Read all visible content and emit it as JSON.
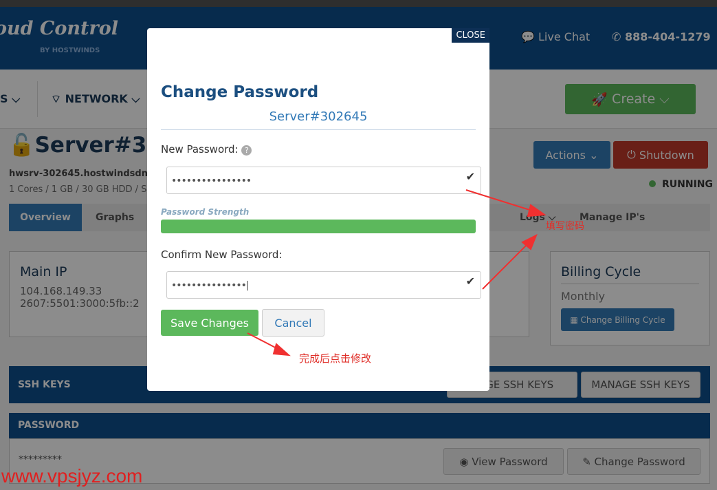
{
  "header": {
    "logo": "oud Control",
    "logo_sub": "BY HOSTWINDS",
    "live_chat": "Live Chat",
    "phone": "888-404-1279"
  },
  "nav": {
    "items": [
      "S",
      "NETWORK"
    ],
    "create": "Create"
  },
  "server": {
    "title": "Server#302",
    "hostname": "hwsrv-302645.hostwindsdns.c",
    "specs": "1 Cores / 1 GB / 30 GB HDD / Se",
    "actions": "Actions",
    "shutdown": "Shutdown",
    "status": "RUNNING"
  },
  "tabs": [
    "Overview",
    "Graphs",
    "l",
    "Logs",
    "Manage IP's"
  ],
  "main_ip": {
    "title": "Main IP",
    "ipv4": "104.168.149.33",
    "ipv6": "2607:5501:3000:5fb::2"
  },
  "billing": {
    "title": "Billing Cycle",
    "value": "Monthly",
    "button": "Change Billing Cycle"
  },
  "ssh": {
    "title": "SSH KEYS",
    "btn1": "ANGE SSH KEYS",
    "btn2": "MANAGE SSH KEYS"
  },
  "password": {
    "title": "PASSWORD",
    "masked": "*********",
    "view": "View Password",
    "change": "Change Password"
  },
  "modal": {
    "close": "CLOSE",
    "title": "Change Password",
    "subtitle": "Server#302645",
    "new_label": "New Password:",
    "new_value": "••••••••••••••••",
    "strength_label": "Password Strength",
    "strength": 1.0,
    "confirm_label": "Confirm New Password:",
    "confirm_value": "•••••••••••••••",
    "save": "Save Changes",
    "cancel": "Cancel"
  },
  "annotations": {
    "fill": "填写密码",
    "after": "完成后点击修改",
    "watermark": "www.vpsjyz.com"
  }
}
